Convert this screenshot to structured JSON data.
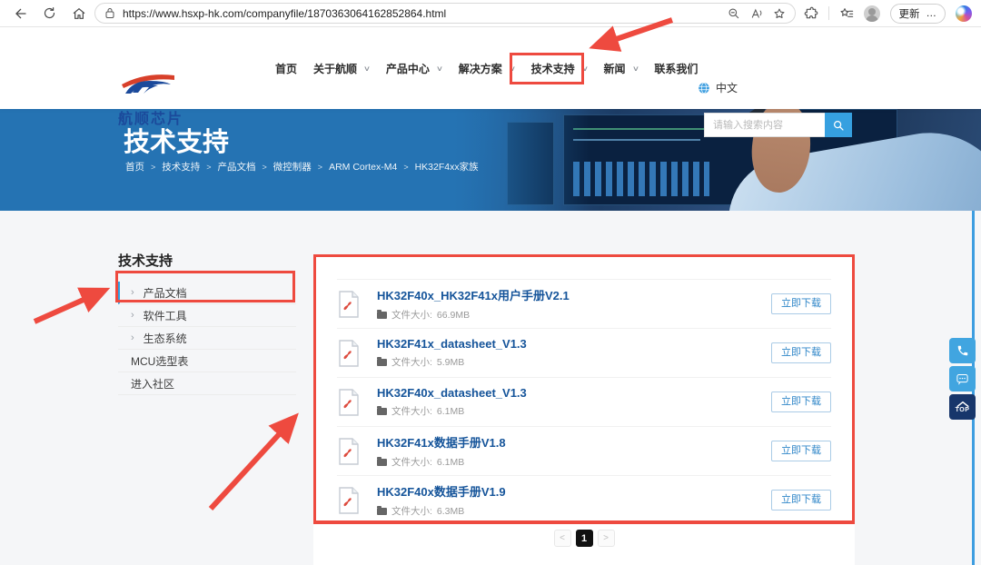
{
  "browser": {
    "url": "https://www.hsxp-hk.com/companyfile/1870363064162852864.html",
    "update_label": "更新"
  },
  "icons": {
    "chevron_down": "∨",
    "chevron_right": "›",
    "breadcrumb_sep": ">",
    "more": "…",
    "pg_prev": "<",
    "pg_next": ">"
  },
  "header": {
    "logo_text": "航顺芯片",
    "nav": [
      {
        "label": "首页"
      },
      {
        "label": "关于航顺"
      },
      {
        "label": "产品中心"
      },
      {
        "label": "解决方案"
      },
      {
        "label": "技术支持"
      },
      {
        "label": "新闻"
      },
      {
        "label": "联系我们"
      }
    ],
    "language": "中文",
    "search_placeholder": "请输入搜索内容"
  },
  "banner": {
    "title": "技术支持",
    "breadcrumb": [
      "首页",
      "技术支持",
      "产品文档",
      "微控制器",
      "ARM Cortex-M4",
      "HK32F4xx家族"
    ]
  },
  "sidebar": {
    "title": "技术支持",
    "items": [
      {
        "label": "产品文档"
      },
      {
        "label": "软件工具"
      },
      {
        "label": "生态系统"
      },
      {
        "label": "MCU选型表"
      },
      {
        "label": "进入社区"
      }
    ]
  },
  "files": {
    "size_label": "文件大小:",
    "download_label": "立即下载",
    "items": [
      {
        "title": "HK32F40x_HK32F41x用户手册V2.1",
        "size": "66.9MB"
      },
      {
        "title": "HK32F41x_datasheet_V1.3",
        "size": "5.9MB"
      },
      {
        "title": "HK32F40x_datasheet_V1.3",
        "size": "6.1MB"
      },
      {
        "title": "HK32F41x数据手册V1.8",
        "size": "6.1MB"
      },
      {
        "title": "HK32F40x数据手册V1.9",
        "size": "6.3MB"
      }
    ]
  },
  "pagination": {
    "current": "1"
  },
  "floating": {
    "top_label": "TOP"
  },
  "colors": {
    "banner_blue": "#2573b3",
    "light_blue": "#36a0e0",
    "link_blue": "#15549a",
    "annotation_red": "#ee4a3f",
    "top_button_navy": "#17366b"
  }
}
